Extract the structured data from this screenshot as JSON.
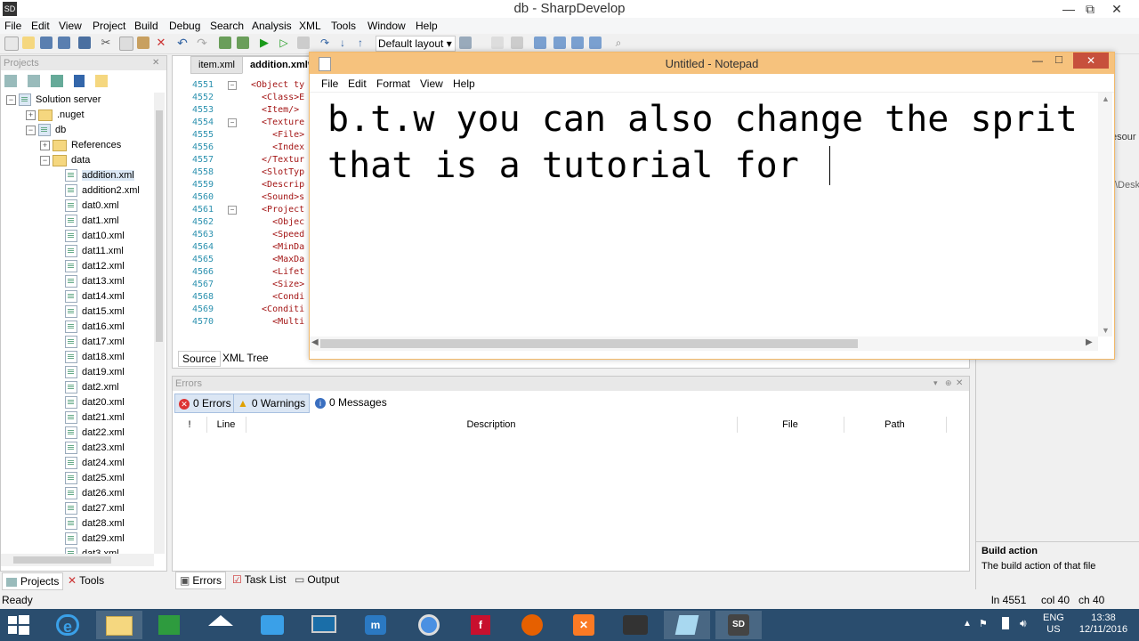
{
  "app": {
    "title": "db - SharpDevelop",
    "minimize": "—",
    "maximize": "⧉",
    "close": "✕"
  },
  "menu": [
    "File",
    "Edit",
    "View",
    "Project",
    "Build",
    "Debug",
    "Search",
    "Analysis",
    "XML",
    "Tools",
    "Window",
    "Help"
  ],
  "toolbar": {
    "layout": "Default layout"
  },
  "projects_pad": {
    "title": "Projects",
    "tree": [
      {
        "label": "Solution server",
        "type": "solution"
      },
      {
        "label": ".nuget",
        "type": "folder"
      },
      {
        "label": "db",
        "type": "project"
      },
      {
        "label": "References",
        "type": "folder"
      },
      {
        "label": "data",
        "type": "folder"
      },
      {
        "label": "addition.xml",
        "type": "file"
      },
      {
        "label": "addition2.xml",
        "type": "file"
      },
      {
        "label": "dat0.xml",
        "type": "file"
      },
      {
        "label": "dat1.xml",
        "type": "file"
      },
      {
        "label": "dat10.xml",
        "type": "file"
      },
      {
        "label": "dat11.xml",
        "type": "file"
      },
      {
        "label": "dat12.xml",
        "type": "file"
      },
      {
        "label": "dat13.xml",
        "type": "file"
      },
      {
        "label": "dat14.xml",
        "type": "file"
      },
      {
        "label": "dat15.xml",
        "type": "file"
      },
      {
        "label": "dat16.xml",
        "type": "file"
      },
      {
        "label": "dat17.xml",
        "type": "file"
      },
      {
        "label": "dat18.xml",
        "type": "file"
      },
      {
        "label": "dat19.xml",
        "type": "file"
      },
      {
        "label": "dat2.xml",
        "type": "file"
      },
      {
        "label": "dat20.xml",
        "type": "file"
      },
      {
        "label": "dat21.xml",
        "type": "file"
      },
      {
        "label": "dat22.xml",
        "type": "file"
      },
      {
        "label": "dat23.xml",
        "type": "file"
      },
      {
        "label": "dat24.xml",
        "type": "file"
      },
      {
        "label": "dat25.xml",
        "type": "file"
      },
      {
        "label": "dat26.xml",
        "type": "file"
      },
      {
        "label": "dat27.xml",
        "type": "file"
      },
      {
        "label": "dat28.xml",
        "type": "file"
      },
      {
        "label": "dat29.xml",
        "type": "file"
      },
      {
        "label": "dat3.xml",
        "type": "file"
      }
    ],
    "bottom_tabs": [
      "Projects",
      "Tools"
    ]
  },
  "editor": {
    "tabs": [
      "item.xml",
      "addition.xml*"
    ],
    "lines": [
      {
        "n": "4551",
        "code": "<Object ty"
      },
      {
        "n": "4552",
        "code": "  <Class>E"
      },
      {
        "n": "4553",
        "code": "  <Item/>"
      },
      {
        "n": "4554",
        "code": "  <Texture"
      },
      {
        "n": "4555",
        "code": "    <File>"
      },
      {
        "n": "4556",
        "code": "    <Index"
      },
      {
        "n": "4557",
        "code": "  </Textur"
      },
      {
        "n": "4558",
        "code": "  <SlotTyp"
      },
      {
        "n": "4559",
        "code": "  <Descrip"
      },
      {
        "n": "4560",
        "code": "  <Sound>s"
      },
      {
        "n": "4561",
        "code": "  <Project"
      },
      {
        "n": "4562",
        "code": "    <Objec"
      },
      {
        "n": "4563",
        "code": "    <Speed"
      },
      {
        "n": "4564",
        "code": "    <MinDa"
      },
      {
        "n": "4565",
        "code": "    <MaxDa"
      },
      {
        "n": "4566",
        "code": "    <Lifet"
      },
      {
        "n": "4567",
        "code": "    <Size>"
      },
      {
        "n": "4568",
        "code": "    <Condi"
      },
      {
        "n": "4569",
        "code": "  <Conditi"
      },
      {
        "n": "4570",
        "code": "    <Multi"
      }
    ],
    "view_tabs": [
      "Source",
      "XML Tree"
    ]
  },
  "notepad": {
    "title": "Untitled - Notepad",
    "menu": [
      "File",
      "Edit",
      "Format",
      "View",
      "Help"
    ],
    "line1": "b.t.w you can also change the sprit",
    "line2": "that is a tutorial for "
  },
  "errors_pad": {
    "title": "Errors",
    "errors": "0 Errors",
    "warnings": "0 Warnings",
    "messages": "0 Messages",
    "columns": [
      "!",
      "Line",
      "Description",
      "File",
      "Path"
    ],
    "bottom_tabs": [
      "Errors",
      "Task List",
      "Output"
    ]
  },
  "properties": {
    "partial_1": "esour",
    "partial_2": "\\Desk",
    "heading": "Build action",
    "description": "The build action of that file"
  },
  "status": {
    "left": "Ready",
    "ln": "ln 4551",
    "col": "col 40",
    "ch": "ch 40"
  },
  "taskbar": {
    "lang": "ENG",
    "region": "US",
    "time": "13:38",
    "date": "12/11/2016"
  },
  "colors": {
    "notepad_title": "#f6c27d",
    "taskbar": "#2a4d6e",
    "code_tag": "#a31515",
    "line_number": "#2b91af"
  }
}
